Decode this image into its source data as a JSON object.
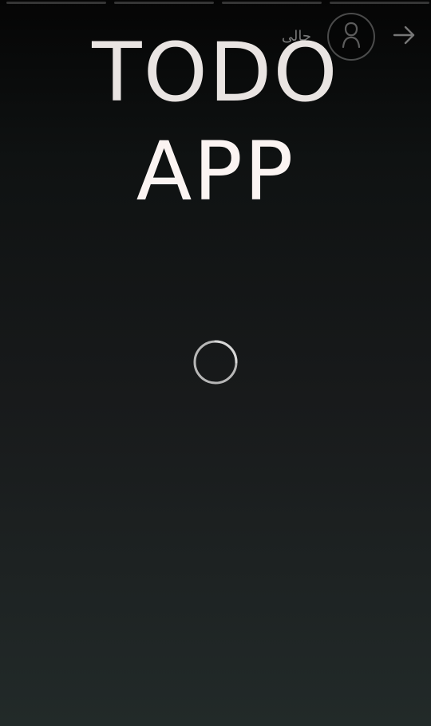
{
  "story": {
    "progress_count": 4,
    "username": "حالی",
    "avatar_icon": "person-icon",
    "next_icon": "arrow-right-icon"
  },
  "content": {
    "title_line1": "TODO",
    "title_line2": "APP",
    "loader_icon": "loading-spinner-icon"
  },
  "colors": {
    "background_top": "#050505",
    "background_bottom": "#222a29",
    "title": "#e9e4e2",
    "spinner": "#b7b7b7"
  }
}
